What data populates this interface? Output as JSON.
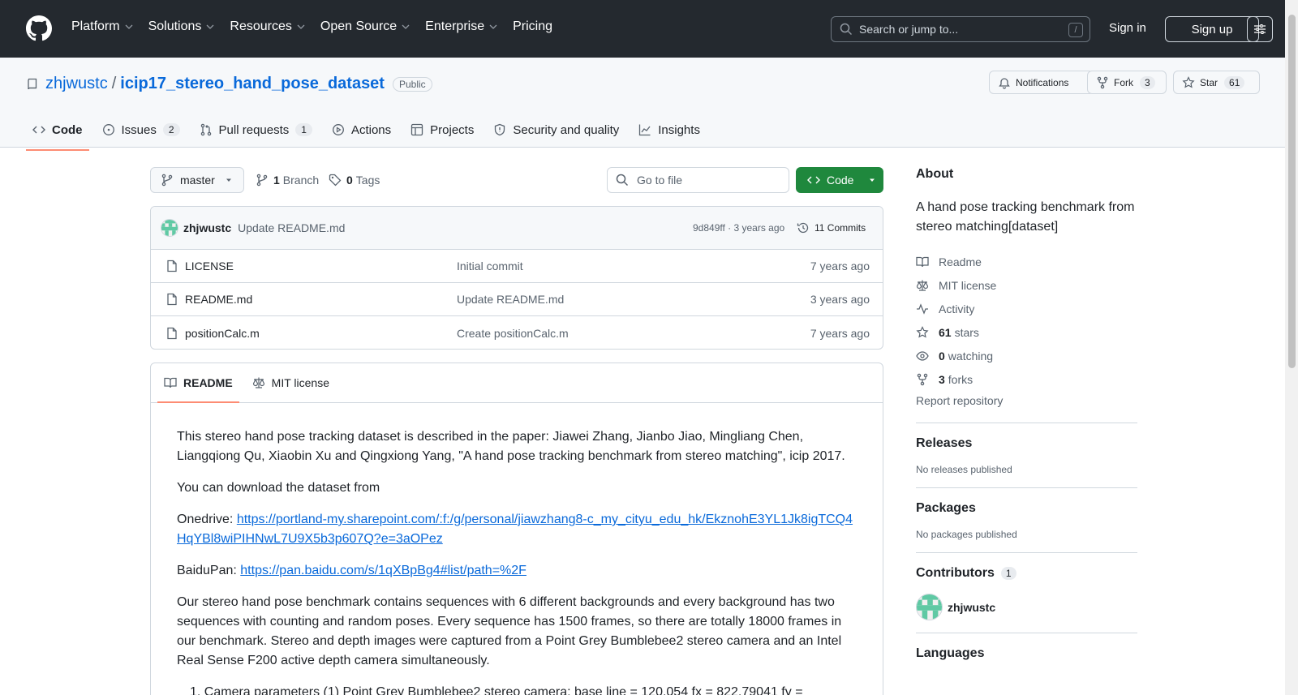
{
  "topnav": {
    "items": [
      "Platform",
      "Solutions",
      "Resources",
      "Open Source",
      "Enterprise",
      "Pricing"
    ],
    "search_placeholder": "Search or jump to...",
    "slash_key": "/",
    "signin": "Sign in",
    "signup": "Sign up"
  },
  "repo": {
    "owner": "zhjwustc",
    "separator": "/",
    "name": "icip17_stereo_hand_pose_dataset",
    "visibility": "Public",
    "notifications": "Notifications",
    "fork_label": "Fork",
    "fork_count": "3",
    "star_label": "Star",
    "star_count": "61"
  },
  "tabs": [
    {
      "label": "Code",
      "count": ""
    },
    {
      "label": "Issues",
      "count": "2"
    },
    {
      "label": "Pull requests",
      "count": "1"
    },
    {
      "label": "Actions",
      "count": ""
    },
    {
      "label": "Projects",
      "count": ""
    },
    {
      "label": "Security and quality",
      "count": ""
    },
    {
      "label": "Insights",
      "count": ""
    }
  ],
  "toolbar": {
    "branch": "master",
    "branch_count": "1",
    "branch_label": "Branch",
    "tag_count": "0",
    "tag_label": "Tags",
    "goto_placeholder": "Go to file",
    "code_label": "Code"
  },
  "commit": {
    "author": "zhjwustc",
    "message": "Update README.md",
    "meta": "9d849ff · 3 years ago",
    "commits": "11 Commits"
  },
  "files": [
    {
      "name": "LICENSE",
      "message": "Initial commit",
      "age": "7 years ago"
    },
    {
      "name": "README.md",
      "message": "Update README.md",
      "age": "3 years ago"
    },
    {
      "name": "positionCalc.m",
      "message": "Create positionCalc.m",
      "age": "7 years ago"
    }
  ],
  "readme": {
    "tab_readme": "README",
    "tab_license": "MIT license",
    "p1": "This stereo hand pose tracking dataset is described in the paper: Jiawei Zhang, Jianbo Jiao, Mingliang Chen, Liangqiong Qu, Xiaobin Xu and Qingxiong Yang, \"A hand pose tracking benchmark from stereo matching\", icip 2017.",
    "p2": "You can download the dataset from",
    "onedrive_label": "Onedrive: ",
    "onedrive_url": "https://portland-my.sharepoint.com/:f:/g/personal/jiawzhang8-c_my_cityu_edu_hk/EkznohE3YL1Jk8igTCQ4HqYBl8wiPIHNwL7U9X5b3p607Q?e=3aOPez",
    "baidu_label": "BaiduPan: ",
    "baidu_url": "https://pan.baidu.com/s/1qXBpBg4#list/path=%2F",
    "p3": "Our stereo hand pose benchmark contains sequences with 6 different backgrounds and every background has two sequences with counting and random poses. Every sequence has 1500 frames, so there are totally 18000 frames in our benchmark. Stereo and depth images were captured from a Point Grey Bumblebee2 stereo camera and an Intel Real Sense F200 active depth camera simultaneously.",
    "p4": "1. Camera parameters (1) Point Grey Bumblebee2 stereo camera: base line = 120.054 fx = 822.79041 fy ="
  },
  "sidebar": {
    "about_title": "About",
    "description": "A hand pose tracking benchmark from stereo matching[dataset]",
    "readme": "Readme",
    "license": "MIT license",
    "activity": "Activity",
    "stars_count": "61",
    "stars_label": "stars",
    "watching_count": "0",
    "watching_label": "watching",
    "forks_count": "3",
    "forks_label": "forks",
    "report": "Report repository",
    "releases_title": "Releases",
    "releases_text": "No releases published",
    "packages_title": "Packages",
    "packages_text": "No packages published",
    "contributors_title": "Contributors",
    "contributors_count": "1",
    "contributor_name": "zhjwustc",
    "languages_title": "Languages"
  },
  "colors": {
    "header_bg": "#24292f",
    "accent_link": "#0969da",
    "code_button": "#1f883d",
    "active_tab_underline": "#fd8c73"
  }
}
